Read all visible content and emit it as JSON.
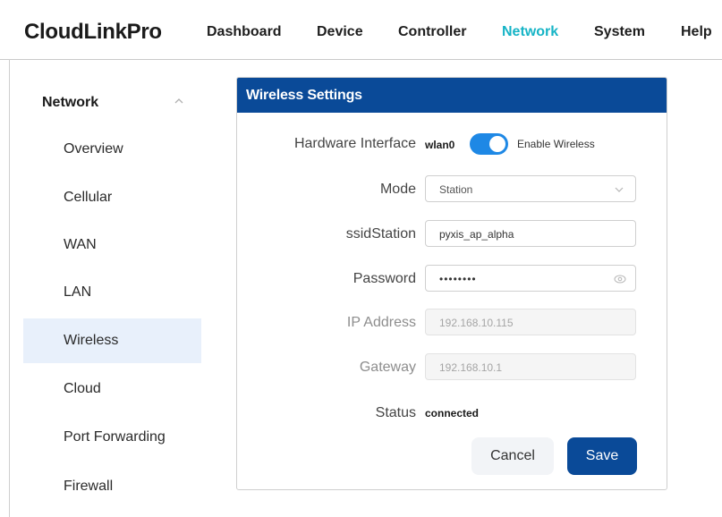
{
  "app": {
    "brand": "CloudLinkPro"
  },
  "nav": {
    "items": [
      "Dashboard",
      "Device",
      "Controller",
      "Network",
      "System",
      "Help"
    ],
    "active": "Network"
  },
  "sidebar": {
    "heading": "Network",
    "items": [
      "Overview",
      "Cellular",
      "WAN",
      "LAN",
      "Wireless",
      "Cloud",
      "Port Forwarding",
      "Firewall"
    ],
    "active": "Wireless"
  },
  "card": {
    "title": "Wireless Settings",
    "hardware_interface": {
      "label": "Hardware Interface",
      "value": "wlan0",
      "toggle_label": "Enable Wireless",
      "enabled": true
    },
    "mode": {
      "label": "Mode",
      "value": "Station"
    },
    "ssid": {
      "label": "ssidStation",
      "value": "pyxis_ap_alpha"
    },
    "password": {
      "label": "Password",
      "value": "••••••••"
    },
    "ip_address": {
      "label": "IP Address",
      "value": "192.168.10.115"
    },
    "gateway": {
      "label": "Gateway",
      "value": "192.168.10.1"
    },
    "status": {
      "label": "Status",
      "value": "connected"
    },
    "buttons": {
      "cancel": "Cancel",
      "save": "Save"
    }
  },
  "colors": {
    "accent": "#16b4c6",
    "primary": "#0a4a98",
    "toggle": "#1e88e5",
    "sidebar_active_bg": "#e8f0fb"
  },
  "icons": {
    "sidebar_chevron": "chevron-up-icon",
    "select_chevron": "chevron-down-icon",
    "password_reveal": "eye-icon"
  }
}
